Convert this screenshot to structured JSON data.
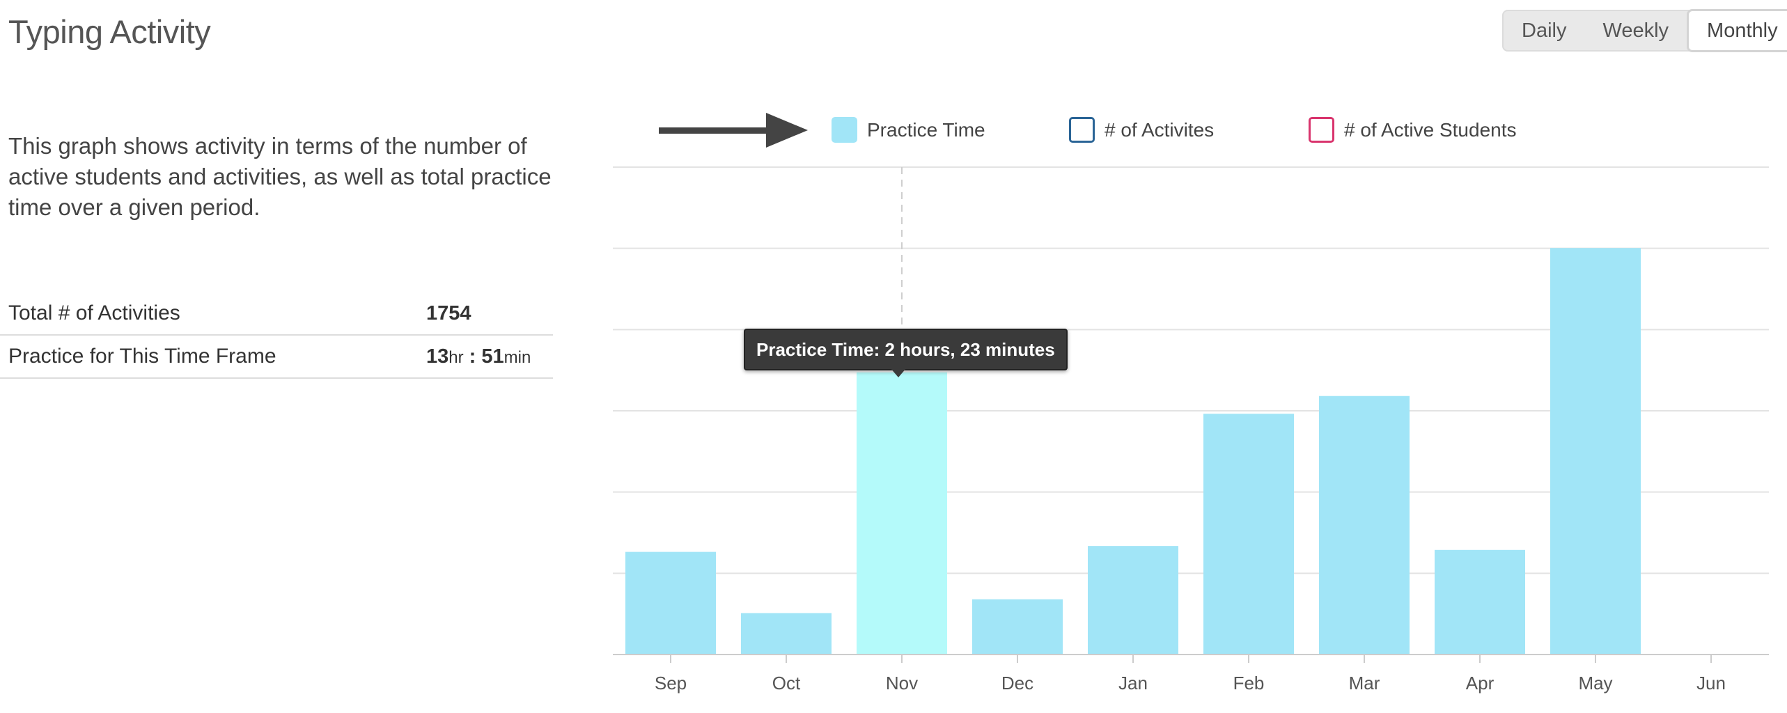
{
  "header": {
    "title": "Typing Activity",
    "ranges": [
      {
        "label": "Daily",
        "active": false
      },
      {
        "label": "Weekly",
        "active": false
      },
      {
        "label": "Monthly",
        "active": true
      }
    ]
  },
  "summary": {
    "description": "This graph shows activity in terms of the number of active students and activities, as well as total practice time over a given period.",
    "total_activities_label": "Total # of Activities",
    "total_activities_value": "1754",
    "practice_label": "Practice for This Time Frame",
    "practice_hours": "13",
    "practice_hours_unit": "hr",
    "practice_sep": " : ",
    "practice_minutes": "51",
    "practice_minutes_unit": "min"
  },
  "legend": {
    "icon": "arrow-right-icon",
    "items": [
      {
        "label": "Practice Time",
        "color": "#a1e5f7",
        "style": "filled"
      },
      {
        "label": "# of Activites",
        "color": "#2a6496",
        "style": "outline"
      },
      {
        "label": "# of Active Students",
        "color": "#d9346d",
        "style": "outline"
      }
    ]
  },
  "tooltip": {
    "text": "Practice Time: 2 hours, 23 minutes"
  },
  "colors": {
    "bar": "#a1e5f7",
    "bar_highlight": "#b4fafa",
    "grid": "#e3e3e3",
    "axis": "#cccccc"
  },
  "chart_data": {
    "type": "bar",
    "categories": [
      "Sep",
      "Oct",
      "Nov",
      "Dec",
      "Jan",
      "Feb",
      "Mar",
      "Apr",
      "May",
      "Jun"
    ],
    "series": [
      {
        "name": "Practice Time",
        "unit": "minutes",
        "values": [
          52,
          21,
          143,
          28,
          55,
          122,
          131,
          53,
          206,
          0
        ]
      }
    ],
    "highlighted_index": 2,
    "ylim": [
      0,
      247
    ],
    "grid": true,
    "legend_position": "top",
    "xlabel": "",
    "ylabel": ""
  }
}
